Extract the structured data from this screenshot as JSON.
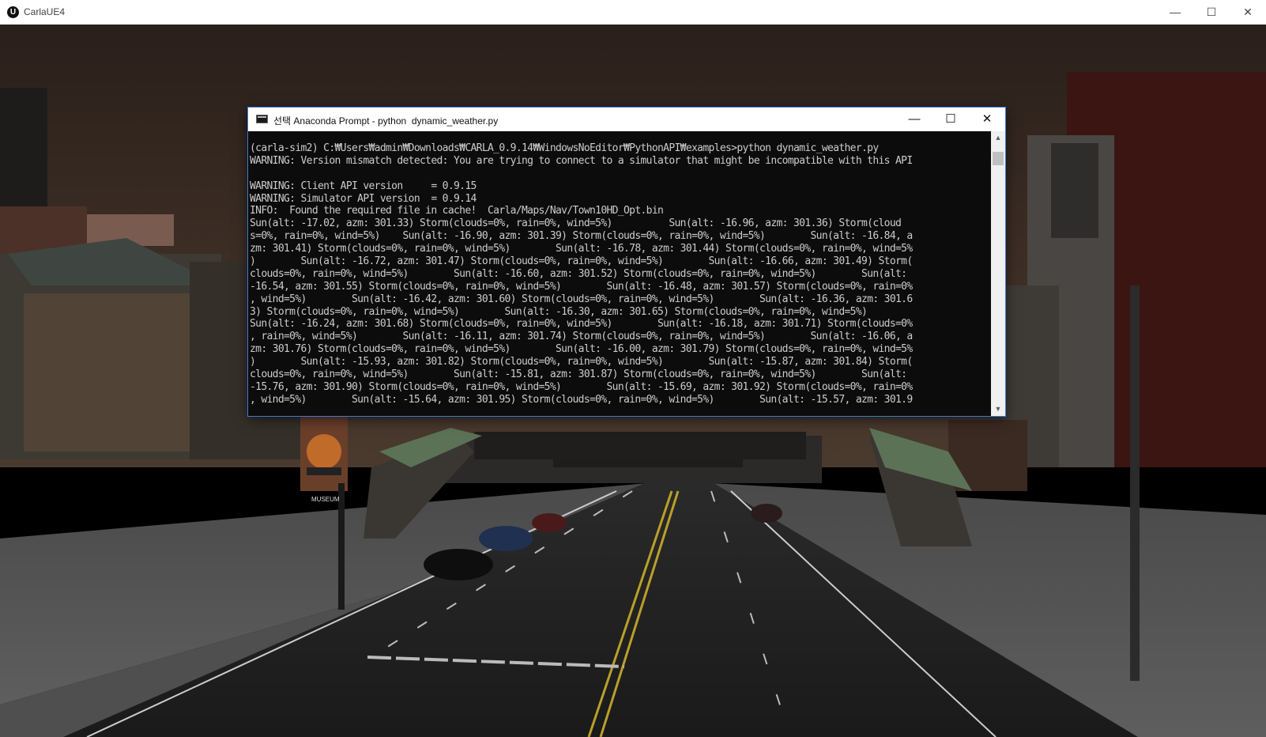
{
  "main_window": {
    "title": "CarlaUE4",
    "logo_glyph": "U",
    "minimize_glyph": "—",
    "maximize_glyph": "☐",
    "close_glyph": "✕"
  },
  "console": {
    "title": "선택 Anaconda Prompt - python  dynamic_weather.py",
    "minimize_glyph": "—",
    "maximize_glyph": "☐",
    "close_glyph": "✕",
    "scroll_up_glyph": "▲",
    "scroll_down_glyph": "▼",
    "lines": [
      "(carla-sim2) C:₩Users₩admin₩Downloads₩CARLA_0.9.14₩WindowsNoEditor₩PythonAPI₩examples>python dynamic_weather.py",
      "WARNING: Version mismatch detected: You are trying to connect to a simulator that might be incompatible with this API",
      "",
      "WARNING: Client API version     = 0.9.15",
      "WARNING: Simulator API version  = 0.9.14",
      "INFO:  Found the required file in cache!  Carla/Maps/Nav/Town10HD_Opt.bin",
      "Sun(alt: -17.02, azm: 301.33) Storm(clouds=0%, rain=0%, wind=5%)          Sun(alt: -16.96, azm: 301.36) Storm(cloud",
      "s=0%, rain=0%, wind=5%)    Sun(alt: -16.90, azm: 301.39) Storm(clouds=0%, rain=0%, wind=5%)        Sun(alt: -16.84, a",
      "zm: 301.41) Storm(clouds=0%, rain=0%, wind=5%)        Sun(alt: -16.78, azm: 301.44) Storm(clouds=0%, rain=0%, wind=5%",
      ")        Sun(alt: -16.72, azm: 301.47) Storm(clouds=0%, rain=0%, wind=5%)        Sun(alt: -16.66, azm: 301.49) Storm(",
      "clouds=0%, rain=0%, wind=5%)        Sun(alt: -16.60, azm: 301.52) Storm(clouds=0%, rain=0%, wind=5%)        Sun(alt:",
      "-16.54, azm: 301.55) Storm(clouds=0%, rain=0%, wind=5%)        Sun(alt: -16.48, azm: 301.57) Storm(clouds=0%, rain=0%",
      ", wind=5%)        Sun(alt: -16.42, azm: 301.60) Storm(clouds=0%, rain=0%, wind=5%)        Sun(alt: -16.36, azm: 301.6",
      "3) Storm(clouds=0%, rain=0%, wind=5%)        Sun(alt: -16.30, azm: 301.65) Storm(clouds=0%, rain=0%, wind=5%)",
      "Sun(alt: -16.24, azm: 301.68) Storm(clouds=0%, rain=0%, wind=5%)        Sun(alt: -16.18, azm: 301.71) Storm(clouds=0%",
      ", rain=0%, wind=5%)        Sun(alt: -16.11, azm: 301.74) Storm(clouds=0%, rain=0%, wind=5%)        Sun(alt: -16.06, a",
      "zm: 301.76) Storm(clouds=0%, rain=0%, wind=5%)        Sun(alt: -16.00, azm: 301.79) Storm(clouds=0%, rain=0%, wind=5%",
      ")        Sun(alt: -15.93, azm: 301.82) Storm(clouds=0%, rain=0%, wind=5%)        Sun(alt: -15.87, azm: 301.84) Storm(",
      "clouds=0%, rain=0%, wind=5%)        Sun(alt: -15.81, azm: 301.87) Storm(clouds=0%, rain=0%, wind=5%)        Sun(alt:",
      "-15.76, azm: 301.90) Storm(clouds=0%, rain=0%, wind=5%)        Sun(alt: -15.69, azm: 301.92) Storm(clouds=0%, rain=0%",
      ", wind=5%)        Sun(alt: -15.64, azm: 301.95) Storm(clouds=0%, rain=0%, wind=5%)        Sun(alt: -15.57, azm: 301.9"
    ]
  },
  "scene": {
    "sign_text": "MUSEUM"
  }
}
